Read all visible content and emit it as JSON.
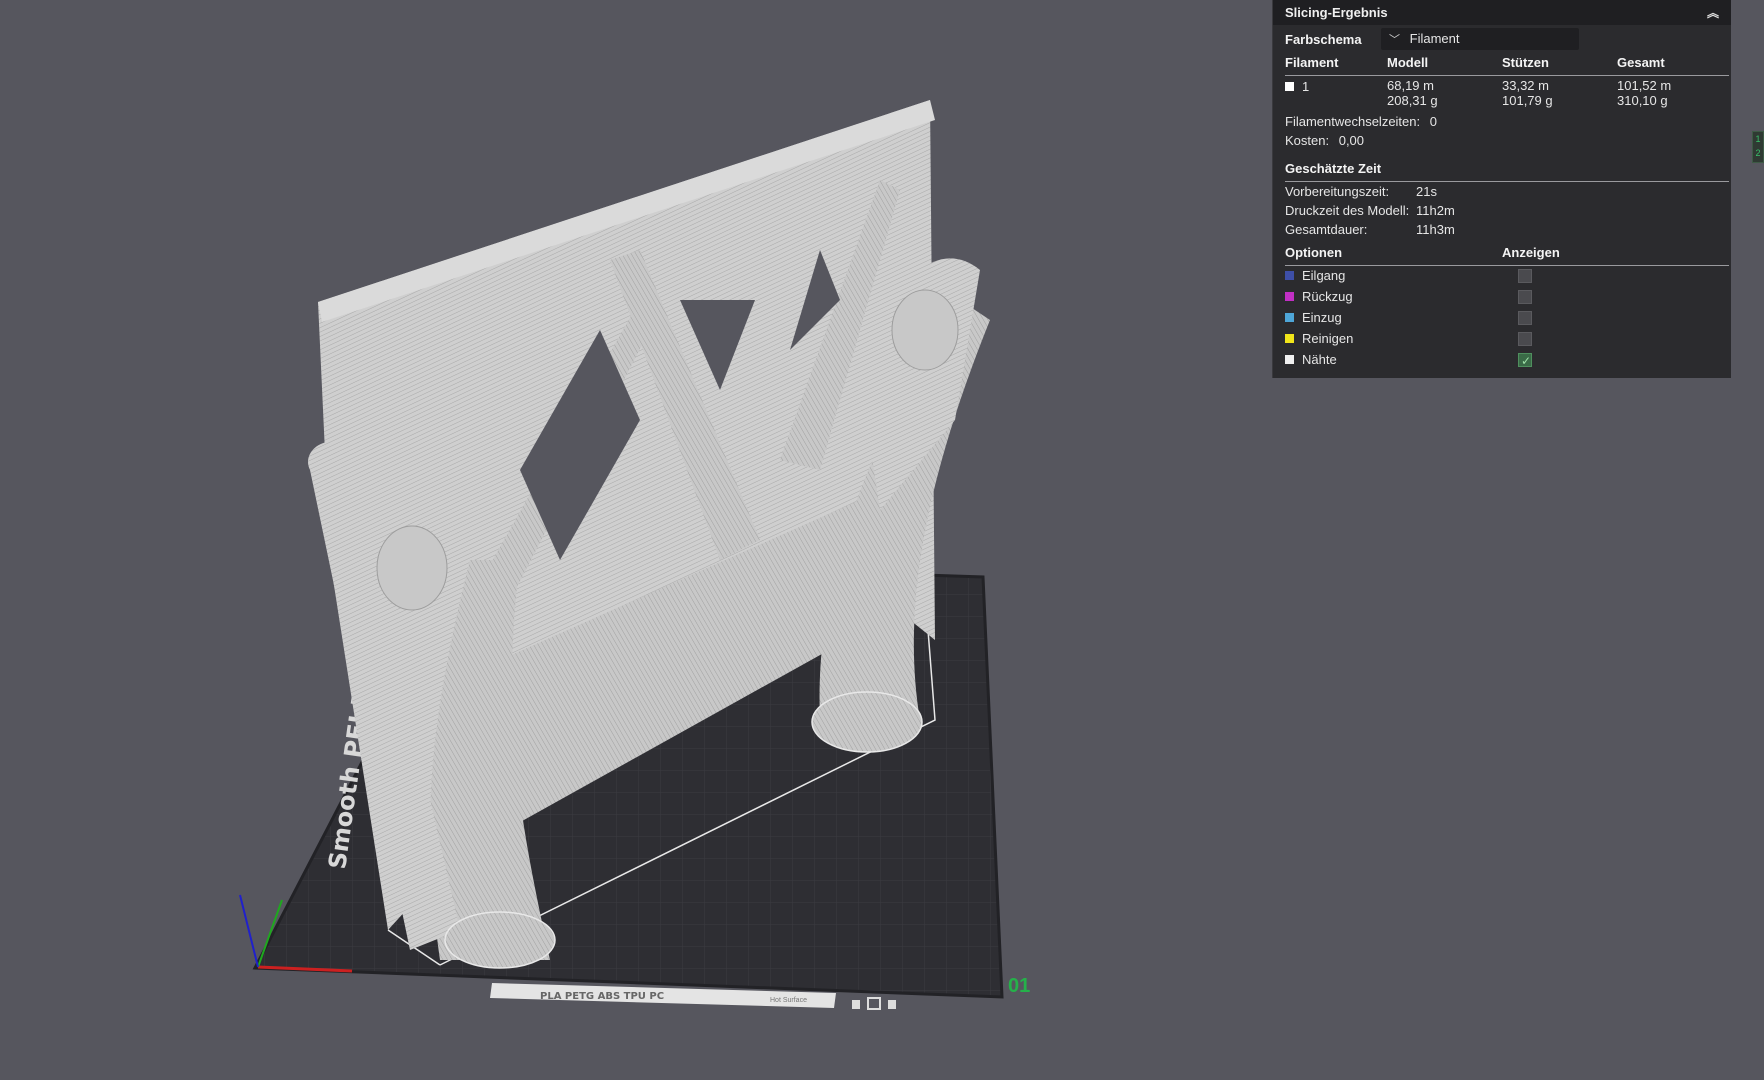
{
  "viewport": {
    "plate_number": "01",
    "plate_side_text": "Smooth PEI Plate",
    "plate_front_text": "PLA PETG ABS TPU PC",
    "plate_front_small": "Hot Surface",
    "model_color": "#c9c9c9",
    "bed_color": "#2e2e33",
    "background_color": "#56565e",
    "accent_green": "#25b14a"
  },
  "panel": {
    "title": "Slicing-Ergebnis",
    "color_scheme_label": "Farbschema",
    "color_scheme_value": "Filament",
    "table_headers": [
      "Filament",
      "Modell",
      "Stützen",
      "Gesamt"
    ],
    "filament_rows": [
      {
        "id": "1",
        "color": "#ffffff",
        "model_len": "68,19 m",
        "model_weight": "208,31 g",
        "support_len": "33,32 m",
        "support_weight": "101,79 g",
        "total_len": "101,52 m",
        "total_weight": "310,10 g"
      }
    ],
    "filament_change_label": "Filamentwechselzeiten:",
    "filament_change_value": "0",
    "cost_label": "Kosten:",
    "cost_value": "0,00",
    "time_header": "Geschätzte Zeit",
    "prep_time_label": "Vorbereitungszeit:",
    "prep_time_value": "21s",
    "print_time_label": "Druckzeit des Modell:",
    "print_time_value": "11h2m",
    "total_time_label": "Gesamtdauer:",
    "total_time_value": "11h3m",
    "options_header": "Optionen",
    "show_header": "Anzeigen",
    "options": [
      {
        "label": "Eilgang",
        "color": "#3e4fa8",
        "checked": false
      },
      {
        "label": "Rückzug",
        "color": "#c12fc4",
        "checked": false
      },
      {
        "label": "Einzug",
        "color": "#4ea6d8",
        "checked": false
      },
      {
        "label": "Reinigen",
        "color": "#f1e51a",
        "checked": false
      },
      {
        "label": "Nähte",
        "color": "#f0f0f0",
        "checked": true
      }
    ]
  },
  "side_tab": {
    "line1": "1",
    "line2": "2"
  }
}
